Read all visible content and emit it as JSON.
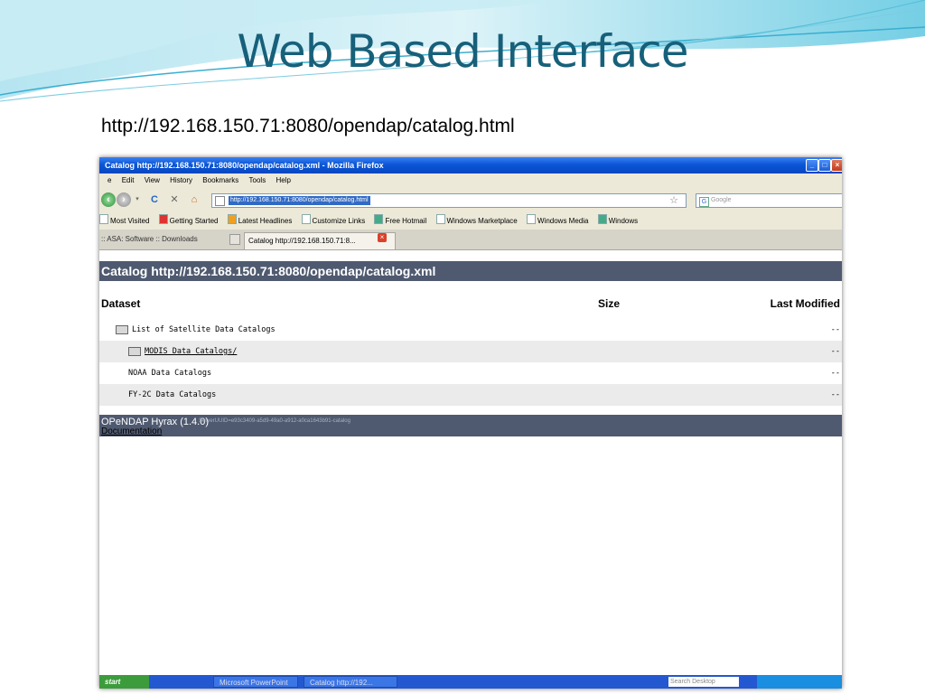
{
  "slide": {
    "title": "Web Based Interface",
    "url": "http://192.168.150.71:8080/opendap/catalog.html"
  },
  "browser": {
    "window_title": "Catalog http://192.168.150.71:8080/opendap/catalog.xml - Mozilla Firefox",
    "menu": [
      "e",
      "Edit",
      "View",
      "History",
      "Bookmarks",
      "Tools",
      "Help"
    ],
    "address": "http://192.168.150.71:8080/opendap/catalog.html",
    "search_placeholder": "Google",
    "bookmarks": [
      "Most Visited",
      "Getting Started",
      "Latest Headlines",
      "Customize Links",
      "Free Hotmail",
      "Windows Marketplace",
      "Windows Media",
      "Windows"
    ],
    "tabs": [
      ":: ASA: Software :: Downloads",
      "Catalog http://192.168.150.71:8..."
    ]
  },
  "catalog": {
    "header": "Catalog http://192.168.150.71:8080/opendap/catalog.xml",
    "columns": {
      "dataset": "Dataset",
      "size": "Size",
      "last_modified": "Last Modified"
    },
    "rows": [
      {
        "name": "List of Satellite Data Catalogs",
        "last_modified": "--"
      },
      {
        "name": "MODIS Data Catalogs/",
        "last_modified": "--"
      },
      {
        "name": "NOAA Data Catalogs",
        "last_modified": "--"
      },
      {
        "name": "FY-2C Data Catalogs",
        "last_modified": "--"
      }
    ],
    "footer_title": "OPeNDAP Hyrax (1.4.0)",
    "footer_server_id": "ServerUUID=e93c3409-a5d9-49a0-a912-a0ca1643b91-catalog",
    "footer_link": "Documentation"
  },
  "taskbar": {
    "start": "start",
    "tasks": [
      "Microsoft PowerPoint",
      "Catalog http://192..."
    ],
    "search": "Search Desktop"
  }
}
